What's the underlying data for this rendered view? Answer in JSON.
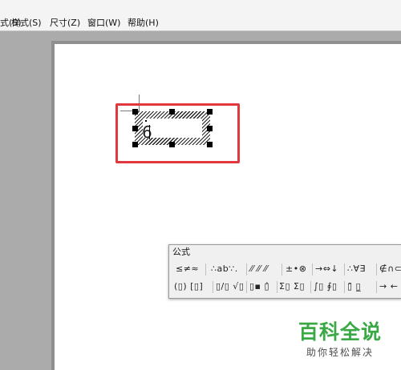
{
  "menubar": {
    "items": [
      "式(S)",
      "样式(S)",
      "尺寸(Z)",
      "窗口(W)",
      "帮助(H)"
    ]
  },
  "formula": {
    "content": "6"
  },
  "palette": {
    "title": "公式",
    "row1": [
      "≤≠≈",
      "∴ab∵.",
      "⁄⁄ ⁄⁄ ⁄⁄",
      "±•⊗",
      "→⇔↓",
      "∴∀∃",
      "∉∩⊂"
    ],
    "row2": [
      "(▯) [▯]",
      "▯/▯ √▯",
      "▯▪ ▯̂",
      "Σ▯ Σ▯",
      "∫▯ ∮▯",
      "▯̄ ▯̲",
      "→ ←"
    ]
  },
  "watermark": {
    "title": "百科全说",
    "subtitle": "助你轻松解决"
  },
  "colors": {
    "highlight": "#e0383c",
    "watermark_green": "#3aa945"
  }
}
